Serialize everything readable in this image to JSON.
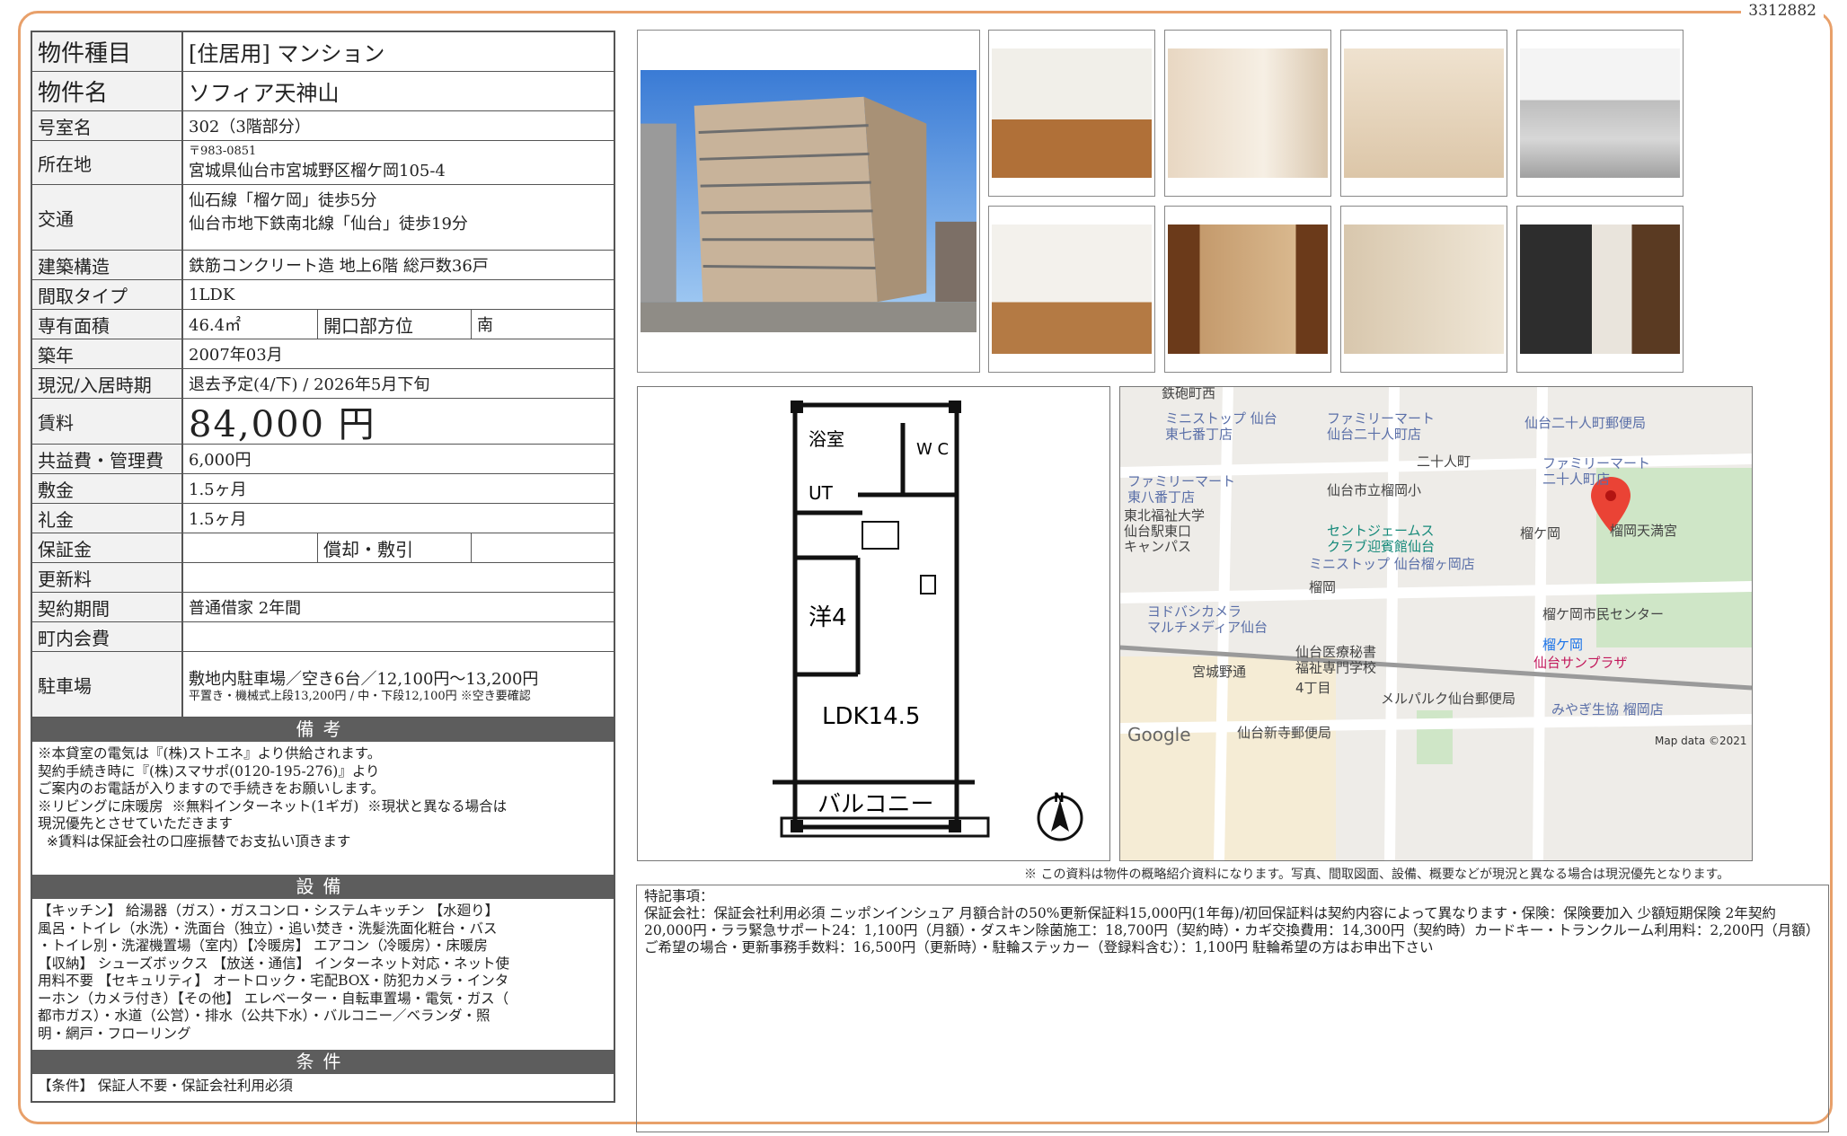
{
  "doc_number": "3312882",
  "spec": {
    "type_label": "物件種目",
    "type_value": "[住居用]  マンション",
    "name_label": "物件名",
    "name_value": "ソフィア天神山",
    "room_label": "号室名",
    "room_value": "302（3階部分）",
    "address_label": "所在地",
    "address_zip": "〒983-0851",
    "address_value": "宮城県仙台市宮城野区榴ケ岡105-4",
    "access_label": "交通",
    "access_line1": "仙石線「榴ケ岡」徒歩5分",
    "access_line2": "仙台市地下鉄南北線「仙台」徒歩19分",
    "structure_label": "建築構造",
    "structure_value": "鉄筋コンクリート造  地上6階  総戸数36戸",
    "layout_label": "間取タイプ",
    "layout_value": "1LDK",
    "area_label": "専有面積",
    "area_value": "46.4㎡",
    "facing_label": "開口部方位",
    "facing_value": "南",
    "built_label": "築年",
    "built_value": "2007年03月",
    "status_label": "現況/入居時期",
    "status_value": "退去予定(4/下)  /  2026年5月下旬",
    "rent_label": "賃料",
    "rent_value": "84,000 円",
    "fee_label": "共益費・管理費",
    "fee_value": "6,000円",
    "deposit_label": "敷金",
    "deposit_value": "1.5ヶ月",
    "key_label": "礼金",
    "key_value": "1.5ヶ月",
    "guarantee_label": "保証金",
    "guarantee_value": "",
    "amort_label": "償却・敷引",
    "amort_value": "",
    "renew_label": "更新料",
    "renew_value": "",
    "contract_label": "契約期間",
    "contract_value": "普通借家  2年間",
    "community_label": "町内会費",
    "community_value": "",
    "parking_label": "駐車場",
    "parking_value": "敷地内駐車場／空き6台／12,100円〜13,200円",
    "parking_note": "平置き・機械式上段13,200円  /  中・下段12,100円  ※空き要確認"
  },
  "remarks_head": "備考",
  "remarks_text": "※本貸室の電気は『(株)ストエネ』より供給されます。\n契約手続き時に『(株)スマサポ(0120-195-276)』より\nご案内のお電話が入りますので手続きをお願いします。\n※リビングに床暖房  ※無料インターネット(1ギガ)  ※現状と異なる場合は\n現況優先とさせていただきます\n  ※賃料は保証会社の口座振替でお支払い頂きます",
  "equipment_head": "設備",
  "equipment_text": "【キッチン】 給湯器（ガス）・ガスコンロ・システムキッチン 【水廻り】\n風呂・トイレ（水洗）・洗面台（独立）・追い焚き・洗髪洗面化粧台・バス\n・トイレ別・洗濯機置場（室内）【冷暖房】 エアコン（冷暖房）・床暖房\n【収納】 シューズボックス 【放送・通信】 インターネット対応・ネット使\n用料不要 【セキュリティ】 オートロック・宅配BOX・防犯カメラ・インタ\nーホン（カメラ付き）【その他】 エレベーター・自転車置場・電気・ガス（\n都市ガス）・水道（公営）・排水（公共下水）・バルコニー／ベランダ・照\n明・網戸・フローリング",
  "conditions_head": "条件",
  "conditions_text": "【条件】 保証人不要・保証会社利用必須",
  "plan": {
    "bath": "浴室",
    "wc": "W C",
    "ut": "UT",
    "western": "洋4",
    "ldk": "LDK14.5",
    "balcony": "バルコニー",
    "north": "N"
  },
  "map": {
    "labels": [
      "鉄砲町西",
      "ミニストップ 仙台\n東七番丁店",
      "ファミリーマート\n仙台二十人町店",
      "仙台二十人町郵便局",
      "二十人町",
      "ファミリーマート\n二十人町店",
      "ファミリーマート\n東八番丁店",
      "仙台市立榴岡小",
      "東北福祉大学\n仙台駅東口\nキャンパス",
      "セントジェームス\nクラブ迎賓館仙台",
      "榴ケ岡",
      "榴岡天満宮",
      "ミニストップ 仙台榴ヶ岡店",
      "榴岡",
      "ヨドバシカメラ\nマルチメディア仙台",
      "榴ケ岡市民センター",
      "榴ケ岡",
      "仙台サンプラザ",
      "仙台医療秘書\n福祉専門学校",
      "宮城野通",
      "4丁目",
      "メルパルク仙台郵便局",
      "みやぎ生協 榴岡店",
      "仙台新寺郵便局"
    ],
    "google": "Google",
    "attribution": "Map data ©2021"
  },
  "disclaimer": "※ この資料は物件の概略紹介資料になります。写真、間取図面、設備、概要などが現況と異なる場合は現況優先となります。",
  "special_head": "特記事項：",
  "special_text": "保証会社：保証会社利用必須 ニッポンインシュア 月額合計の50%更新保証料15,000円(1年毎)/初回保証料は契約内容によって異なります・保険：保険要加入 少額短期保険 2年契約 20,000円・ララ緊急サポート24：1,100円（月額）・ダスキン除菌施工：18,700円（契約時）・カギ交換費用：14,300円（契約時）カードキー・トランクルーム利用料：2,200円（月額）ご希望の場合・更新事務手数料：16,500円（更新時）・駐輪ステッカー（登録料含む）：1,100円 駐輪希望の方はお申出下さい"
}
